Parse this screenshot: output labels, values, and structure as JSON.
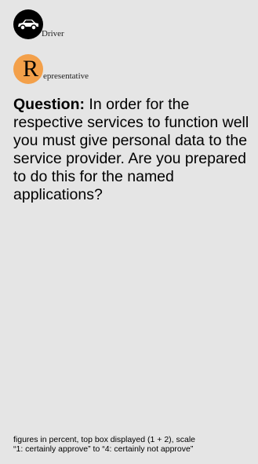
{
  "legend": {
    "driver": {
      "icon": "car-icon",
      "label": "Driver",
      "color": "#000000"
    },
    "representative": {
      "letter": "R",
      "label": "epresentative",
      "color": "#f3a04a"
    }
  },
  "question": {
    "lead": "Question:",
    "text": " In order for the respective services to function well you must give personal data to the service provider. Are you prepared to do this for the named applications?"
  },
  "footnote": {
    "line1": "figures in percent, top box displayed (1 + 2), scale",
    "line2": "“1: certainly approve” to “4: certainly not approve”"
  }
}
